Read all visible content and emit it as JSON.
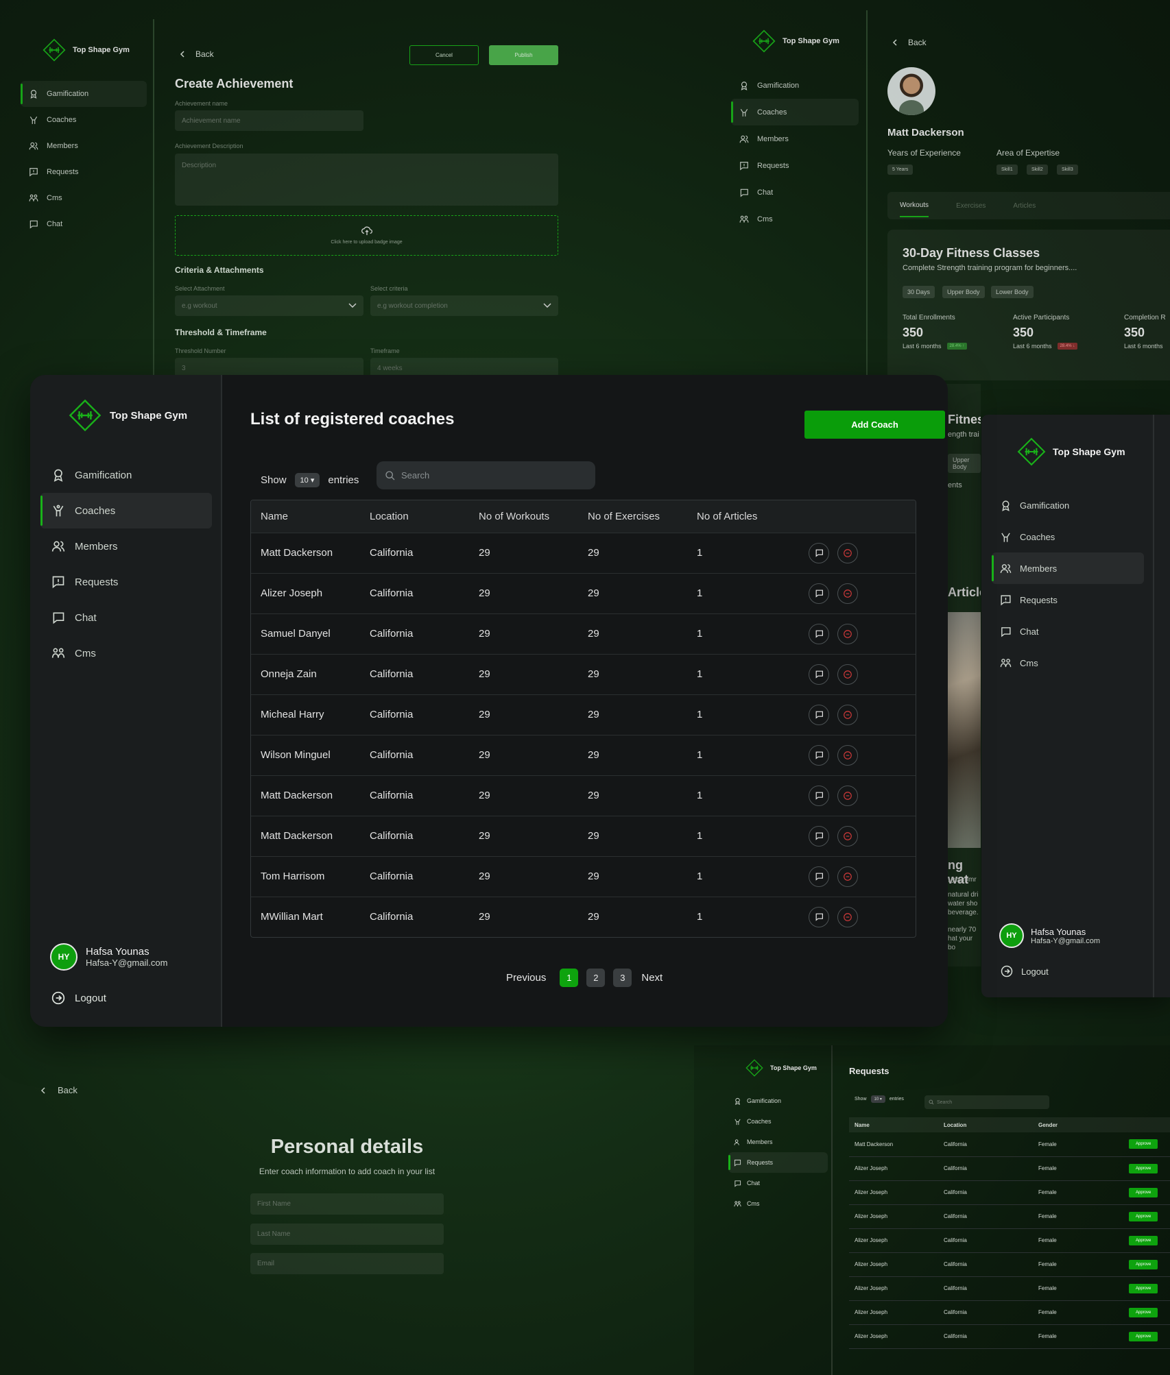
{
  "brand": {
    "name": "Top Shape Gym",
    "accent": "#0ea30e",
    "danger": "#d23a3a"
  },
  "nav": [
    "Gamification",
    "Coaches",
    "Members",
    "Requests",
    "Cms",
    "Chat"
  ],
  "nav_b": [
    "Gamification",
    "Coaches",
    "Members",
    "Requests",
    "Chat",
    "Cms"
  ],
  "user": {
    "initials": "HY",
    "name": "Hafsa Younas",
    "email": "Hafsa-Y@gmail.com",
    "logout": "Logout"
  },
  "achievement": {
    "back": "Back",
    "cancel": "Cancel",
    "publish": "Publish",
    "title": "Create Achievement",
    "name_label": "Achievement name",
    "name_placeholder": "Achievement name",
    "desc_label": "Achievement Description",
    "desc_placeholder": "Description",
    "upload_text": "Click here to upload badge image",
    "criteria_title": "Criteria & Attachments",
    "attach_label": "Select Attachment",
    "attach_placeholder": "e.g workout",
    "criteria_label": "Select criteria",
    "criteria_placeholder": "e.g workout completion",
    "threshold_title": "Threshold & Timeframe",
    "threshold_label": "Threshold Number",
    "threshold_placeholder": "3",
    "timeframe_label": "Timeframe",
    "timeframe_placeholder": "4 weeks"
  },
  "profile": {
    "back": "Back",
    "name": "Matt Dackerson",
    "exp_label": "Years of Experience",
    "exp_value": "5 Years",
    "expertise_label": "Area of Expertise",
    "skills": [
      "Skill1",
      "Skill2",
      "Skill3"
    ],
    "tabs": [
      "Workouts",
      "Exercises",
      "Articles"
    ],
    "card_title": "30-Day Fitness Classes",
    "card_sub": "Complete Strength training program for beginners....",
    "tags": [
      "30 Days",
      "Upper Body",
      "Lower Body"
    ],
    "stats": [
      {
        "label": "Total Enrollments",
        "value": "350",
        "period": "Last 6 months",
        "badge": "28.4% ↑"
      },
      {
        "label": "Active Participants",
        "value": "350",
        "period": "Last 6 months",
        "badge": "28.4% ↓"
      },
      {
        "label": "Completion R",
        "value": "350",
        "period": "Last 6 months",
        "badge": ""
      }
    ]
  },
  "peek": {
    "title_frag": "Fitnes",
    "sub_frag": "ength trai",
    "tag_frag": "Upper Body",
    "row_frag": "ents",
    "article_frag": "Article",
    "text_head": "ng wat",
    "text_lines": [
      ", your imr",
      "natural dri",
      "water sho",
      "beverage.",
      "nearly 70",
      "hat your bo"
    ]
  },
  "coaches": {
    "title": "List of registered coaches",
    "add_button": "Add Coach",
    "show_label": "Show",
    "entries_value": "10",
    "entries_label": "entries",
    "search_placeholder": "Search",
    "columns": [
      "Name",
      "Location",
      "No of Workouts",
      "No of Exercises",
      "No of Articles"
    ],
    "rows": [
      [
        "Matt Dackerson",
        "California",
        "29",
        "29",
        "1"
      ],
      [
        "Alizer Joseph",
        "California",
        "29",
        "29",
        "1"
      ],
      [
        "Samuel Danyel",
        "California",
        "29",
        "29",
        "1"
      ],
      [
        "Onneja Zain",
        "California",
        "29",
        "29",
        "1"
      ],
      [
        "Micheal Harry",
        "California",
        "29",
        "29",
        "1"
      ],
      [
        "Wilson Minguel",
        "California",
        "29",
        "29",
        "1"
      ],
      [
        "Matt Dackerson",
        "California",
        "29",
        "29",
        "1"
      ],
      [
        "Matt Dackerson",
        "California",
        "29",
        "29",
        "1"
      ],
      [
        "Tom Harrisom",
        "California",
        "29",
        "29",
        "1"
      ],
      [
        "MWillian Mart",
        "California",
        "29",
        "29",
        "1"
      ]
    ],
    "prev": "Previous",
    "pages": [
      "1",
      "2",
      "3"
    ],
    "next": "Next"
  },
  "personal": {
    "back": "Back",
    "title": "Personal details",
    "subtitle": "Enter coach information to add coach in your list",
    "fields": [
      "First Name",
      "Last Name",
      "Email"
    ]
  },
  "requests": {
    "title": "Requests",
    "show_label": "Show",
    "entries_value": "10",
    "entries_label": "entries",
    "search_placeholder": "Search",
    "columns": [
      "Name",
      "Location",
      "Gender"
    ],
    "approve": "Approve",
    "rows": [
      [
        "Matt Dackerson",
        "California",
        "Female"
      ],
      [
        "Alizer Joseph",
        "California",
        "Female"
      ],
      [
        "Alizer Joseph",
        "California",
        "Female"
      ],
      [
        "Alizer Joseph",
        "California",
        "Female"
      ],
      [
        "Alizer Joseph",
        "California",
        "Female"
      ],
      [
        "Alizer Joseph",
        "California",
        "Female"
      ],
      [
        "Alizer Joseph",
        "California",
        "Female"
      ],
      [
        "Alizer Joseph",
        "California",
        "Female"
      ],
      [
        "Alizer Joseph",
        "California",
        "Female"
      ]
    ]
  }
}
